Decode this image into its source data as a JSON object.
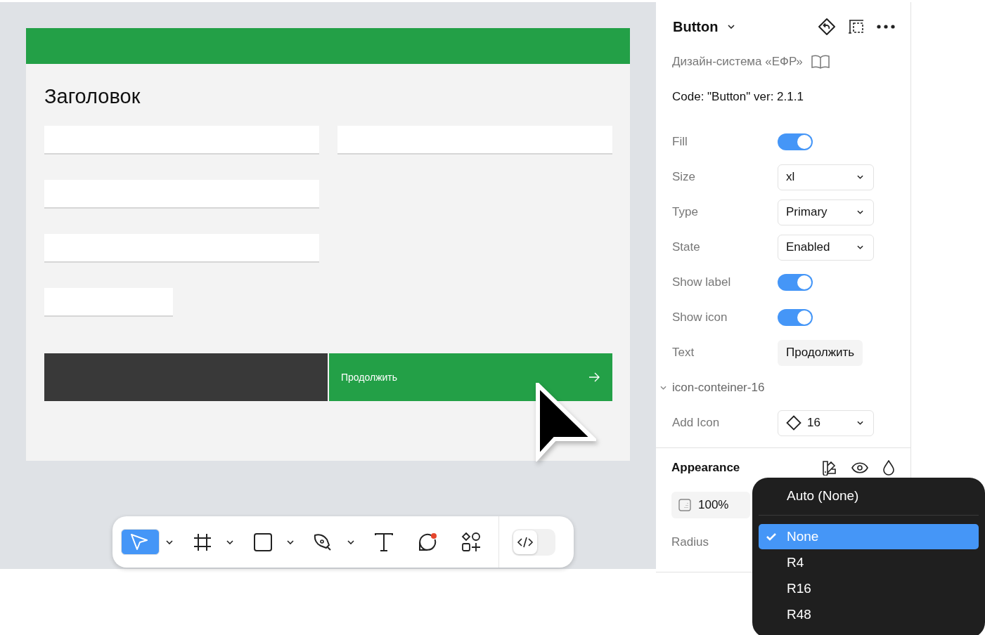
{
  "canvas": {
    "frame_title": "Заголовок",
    "primary_button": {
      "label": "Продолжить"
    }
  },
  "toolbar": {
    "tools": [
      {
        "kind": "move",
        "selected": true,
        "dropdown": true
      },
      {
        "kind": "frame",
        "selected": false,
        "dropdown": true
      },
      {
        "kind": "rectangle",
        "selected": false,
        "dropdown": true
      },
      {
        "kind": "pen",
        "selected": false,
        "dropdown": true
      },
      {
        "kind": "text",
        "selected": false,
        "dropdown": false
      },
      {
        "kind": "comment",
        "selected": false,
        "dropdown": false
      },
      {
        "kind": "components",
        "selected": false,
        "dropdown": false
      }
    ],
    "dev_mode": {
      "on": false
    }
  },
  "panel": {
    "title": "Button",
    "library": "Дизайн-система «ЕФР»",
    "code_note": "Code: \"Button\" ver: 2.1.1",
    "properties": [
      {
        "kind": "toggle",
        "label": "Fill",
        "on": true
      },
      {
        "kind": "select",
        "label": "Size",
        "value": "xl"
      },
      {
        "kind": "select",
        "label": "Type",
        "value": "Primary"
      },
      {
        "kind": "select",
        "label": "State",
        "value": "Enabled"
      },
      {
        "kind": "toggle",
        "label": "Show label",
        "on": true
      },
      {
        "kind": "toggle",
        "label": "Show icon",
        "on": true
      },
      {
        "kind": "text",
        "label": "Text",
        "value": "Продолжить"
      }
    ],
    "nested": {
      "name": "icon-conteiner-16",
      "expanded": true,
      "properties": [
        {
          "kind": "instance",
          "label": "Add Icon",
          "value": "16"
        }
      ]
    },
    "appearance": {
      "title": "Appearance",
      "opacity": "100%",
      "radius_label": "Radius"
    }
  },
  "radius_menu": {
    "items": [
      {
        "kind": "auto",
        "label": "Auto (None)",
        "selected": false
      },
      {
        "kind": "option",
        "label": "None",
        "selected": true
      },
      {
        "kind": "option",
        "label": "R4",
        "selected": false
      },
      {
        "kind": "option",
        "label": "R16",
        "selected": false
      },
      {
        "kind": "option",
        "label": "R48",
        "selected": false
      }
    ]
  }
}
